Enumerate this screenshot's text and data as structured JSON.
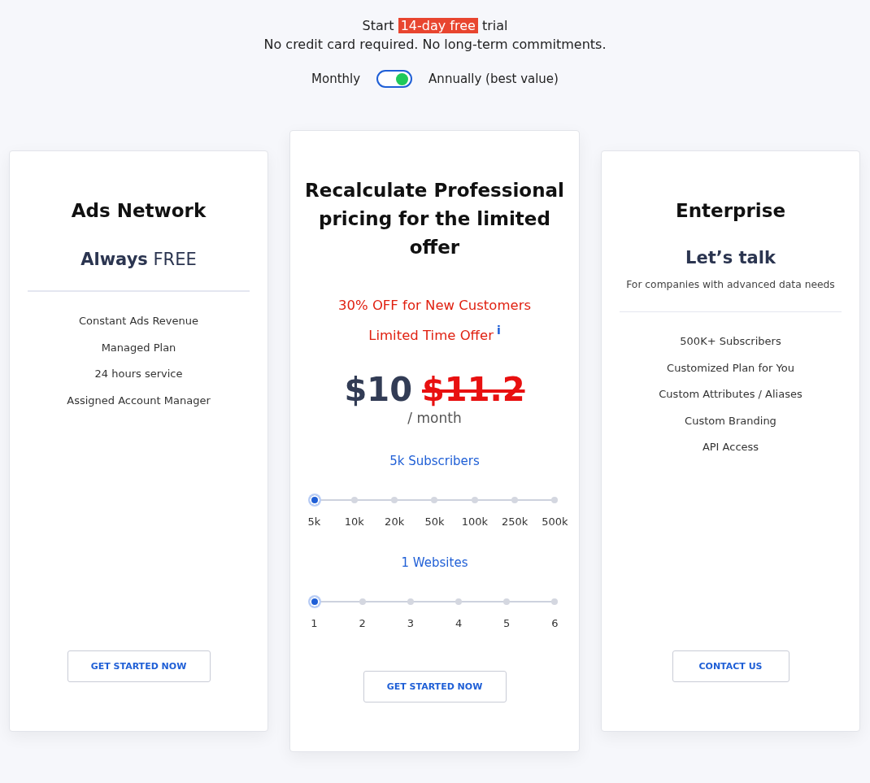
{
  "header": {
    "trial_prefix": "Start",
    "trial_highlight": "14-day free",
    "trial_suffix": "trial",
    "subtitle": "No credit card required. No long-term commitments."
  },
  "billing_toggle": {
    "left_label": "Monthly",
    "right_label": "Annually (best value)",
    "on": true
  },
  "plans": [
    {
      "kind": "free",
      "title": "Ads Network",
      "price": "**Always** FREE",
      "features": [
        "Constant Ads Revenue",
        "Managed Plan",
        "24 hours service",
        "Assigned Account Manager"
      ],
      "button": "GET STARTED NOW"
    },
    {
      "kind": "pro",
      "title": "Recalculate Professional pricing for the limited offer",
      "offer_lines": [
        "30% OFF for New Customers",
        "Limited Time Offer"
      ],
      "info_icon": "i",
      "price": "$10",
      "old_price": "$11.2",
      "period": "/ month",
      "sliders": [
        {
          "label": "5k Subscribers",
          "stops": [
            {
              "label": "5k",
              "selected": true
            },
            {
              "label": "10k",
              "selected": false
            },
            {
              "label": "20k",
              "selected": false
            },
            {
              "label": "50k",
              "selected": false
            },
            {
              "label": "100k",
              "selected": false
            },
            {
              "label": "250k",
              "selected": false
            },
            {
              "label": "500k",
              "selected": false
            }
          ]
        },
        {
          "label": "1 Websites",
          "stops": [
            {
              "label": "1",
              "selected": true
            },
            {
              "label": "2",
              "selected": false
            },
            {
              "label": "3",
              "selected": false
            },
            {
              "label": "4",
              "selected": false
            },
            {
              "label": "5",
              "selected": false
            },
            {
              "label": "6",
              "selected": false
            }
          ]
        }
      ],
      "button": "GET STARTED NOW"
    },
    {
      "kind": "enterprise",
      "title": "Enterprise",
      "price": "Let’s talk",
      "description": "For companies with advanced data needs",
      "features": [
        "500K+ Subscribers",
        "Customized Plan for You",
        "Custom Attributes / Aliases",
        "Custom Branding",
        "API Access"
      ],
      "button": "CONTACT US"
    }
  ]
}
